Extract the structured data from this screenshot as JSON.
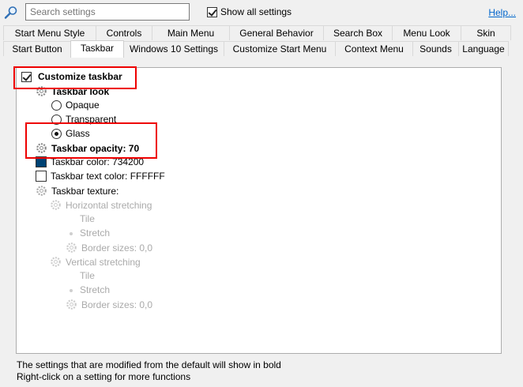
{
  "search": {
    "placeholder": "Search settings"
  },
  "show_all": {
    "label": "Show all settings",
    "checked": true
  },
  "help": {
    "label": "Help..."
  },
  "tabs": {
    "row1": [
      {
        "label": "Start Menu Style"
      },
      {
        "label": "Controls"
      },
      {
        "label": "Main Menu"
      },
      {
        "label": "General Behavior"
      },
      {
        "label": "Search Box"
      },
      {
        "label": "Menu Look"
      },
      {
        "label": "Skin"
      }
    ],
    "row2": [
      {
        "label": "Start Button"
      },
      {
        "label": "Taskbar",
        "active": true
      },
      {
        "label": "Windows 10 Settings"
      },
      {
        "label": "Customize Start Menu"
      },
      {
        "label": "Context Menu"
      },
      {
        "label": "Sounds"
      },
      {
        "label": "Language"
      }
    ]
  },
  "settings": {
    "customize_taskbar": "Customize taskbar",
    "taskbar_look": "Taskbar look",
    "opaque": "Opaque",
    "transparent": "Transparent",
    "glass": "Glass",
    "taskbar_opacity": "Taskbar opacity: 70",
    "taskbar_color": "Taskbar color: 734200",
    "taskbar_text_color": "Taskbar text color: FFFFFF",
    "taskbar_texture": "Taskbar texture:",
    "horizontal_stretching": "Horizontal stretching",
    "h_tile": "Tile",
    "h_stretch": "Stretch",
    "h_border_sizes": "Border sizes: 0,0",
    "vertical_stretching": "Vertical stretching",
    "v_tile": "Tile",
    "v_stretch": "Stretch",
    "v_border_sizes": "Border sizes: 0,0"
  },
  "colors": {
    "taskbar_color": "#004273",
    "taskbar_text_color": "#FFFFFF",
    "highlight": "#e00000"
  },
  "footer": {
    "line1": "The settings that are modified from the default will show in bold",
    "line2": "Right-click on a setting for more functions"
  }
}
